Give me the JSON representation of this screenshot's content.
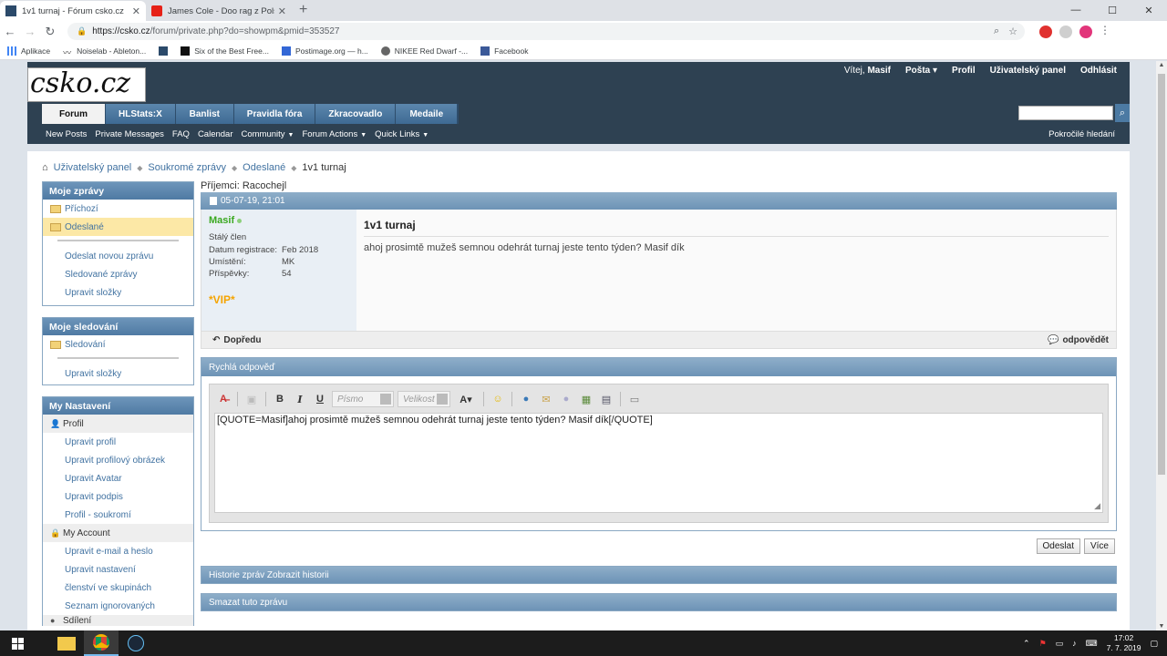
{
  "browser": {
    "tabs": [
      {
        "title": "1v1 turnaj - Fórum csko.cz",
        "active": true
      },
      {
        "title": "James Cole - Doo rag z Polsk",
        "active": false
      }
    ],
    "url_host": "https://csko.cz",
    "url_path": "/forum/private.php?do=showpm&pmid=353527",
    "bookmarks": [
      "Aplikace",
      "Noiselab - Ableton...",
      "",
      "Six of the Best Free...",
      "Postimage.org — h...",
      "NIKEE Red Dwarf -...",
      "Facebook"
    ]
  },
  "site": {
    "logo": "csko.cz",
    "welcome": "Vítej,",
    "username": "Masif",
    "toplinks": [
      "Pošta",
      "Profil",
      "Uživatelský panel",
      "Odhlásit"
    ],
    "navtabs": [
      "Forum",
      "HLStats:X",
      "Banlist",
      "Pravidla fóra",
      "Zkracovadlo",
      "Medaile"
    ],
    "subnav": [
      "New Posts",
      "Private Messages",
      "FAQ",
      "Calendar",
      "Community",
      "Forum Actions",
      "Quick Links"
    ],
    "advanced_search": "Pokročilé hledání"
  },
  "breadcrumb": [
    "Uživatelský panel",
    "Soukromé zprávy",
    "Odeslané",
    "1v1 turnaj"
  ],
  "sidebar": {
    "my_messages": {
      "title": "Moje zprávy",
      "items": [
        "Příchozí",
        "Odeslané"
      ],
      "links": [
        "Odeslat novou zprávu",
        "Sledované zprávy",
        "Upravit složky"
      ]
    },
    "my_subscriptions": {
      "title": "Moje sledování",
      "items": [
        "Sledování"
      ],
      "links": [
        "Upravit složky"
      ]
    },
    "my_settings": {
      "title": "My Nastavení",
      "profile_head": "Profil",
      "profile_links": [
        "Upravit profil",
        "Upravit profilový obrázek",
        "Upravit Avatar",
        "Upravit podpis",
        "Profil - soukromí"
      ],
      "account_head": "My Account",
      "account_links": [
        "Upravit e-mail a heslo",
        "Upravit nastavení",
        "členství ve skupinách",
        "Seznam ignorovaných"
      ],
      "more_head": "Sdílení"
    }
  },
  "message": {
    "recipients_label": "Příjemci:",
    "recipient": "Racochejl",
    "date": "05-07-19, 21:01",
    "author": "Masif",
    "rank": "Stálý člen",
    "info": [
      {
        "k": "Datum registrace:",
        "v": "Feb 2018"
      },
      {
        "k": "Umístění:",
        "v": "MK"
      },
      {
        "k": "Příspěvky:",
        "v": "54"
      }
    ],
    "vip": "*VIP*",
    "title": "1v1 turnaj",
    "body": "ahoj prosimtě mužeš semnou odehrát turnaj jeste tento týden? Masif dík",
    "forward": "Dopředu",
    "reply": "odpovědět"
  },
  "quick_reply": {
    "title": "Rychlá odpověď",
    "font_placeholder": "Písmo",
    "size_placeholder": "Velikost",
    "text": "[QUOTE=Masif]ahoj prosimtě mužeš semnou odehrát turnaj jeste tento týden?  Masif dík[/QUOTE]",
    "submit": "Odeslat",
    "more": "Více"
  },
  "history_bar": "Historie zpráv Zobrazit historii",
  "delete_bar": "Smazat tuto zprávu",
  "taskbar": {
    "time": "17:02",
    "date": "7. 7. 2019"
  }
}
